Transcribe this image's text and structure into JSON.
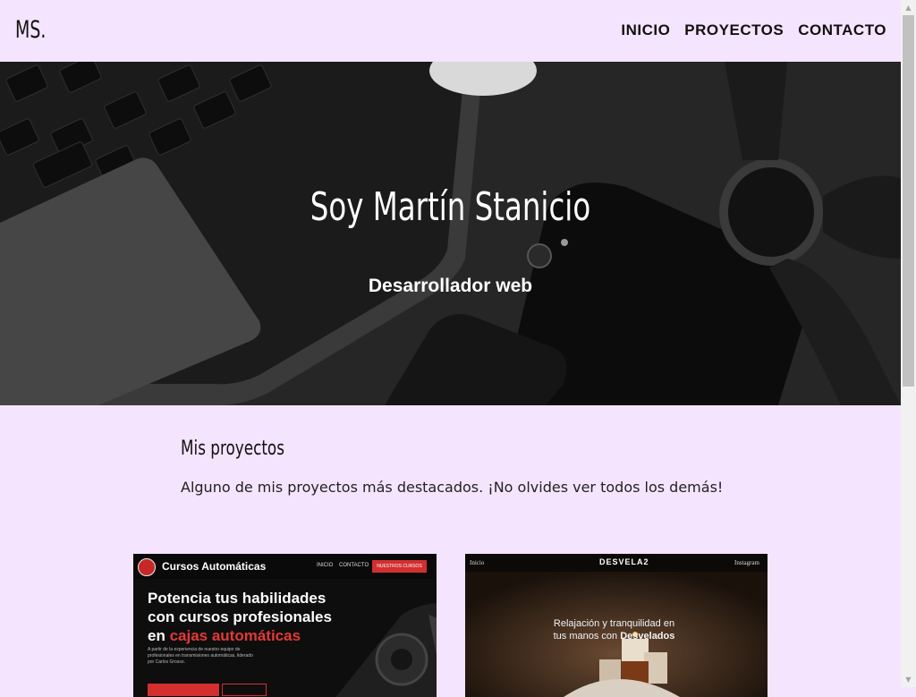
{
  "header": {
    "logo": "MS.",
    "nav": [
      "INICIO",
      "PROYECTOS",
      "CONTACTO"
    ]
  },
  "hero": {
    "title": "Soy Martín Stanicio",
    "subtitle": "Desarrollador web"
  },
  "projects": {
    "title": "Mis proyectos",
    "description": "Alguno de mis proyectos más destacados. ¡No olvides ver todos los demás!",
    "cards": [
      {
        "brand": "Cursos Automáticas",
        "nav_inicio": "INICIO",
        "nav_contacto": "CONTACTO",
        "button": "NUESTROS CURSOS",
        "headline_1": "Potencia tus habilidades",
        "headline_2": "con cursos profesionales",
        "headline_3": "en",
        "headline_red": "cajas automáticas",
        "small_text": "A partir de la experiencia de nuestro equipo de profesionales en transmisiones automáticas, liderado por Carlos Grosso."
      },
      {
        "nav_left": "Inicio",
        "logo": "DESVELA2",
        "nav_right": "Instagram",
        "text_1": "Relajación y tranquilidad en",
        "text_2": "tus manos con",
        "text_bold": "Desvelados"
      }
    ]
  },
  "colors": {
    "page_background": "#f5e4fd",
    "hero_overlay": "#2b2b2b",
    "accent_red": "#d32f2f"
  }
}
